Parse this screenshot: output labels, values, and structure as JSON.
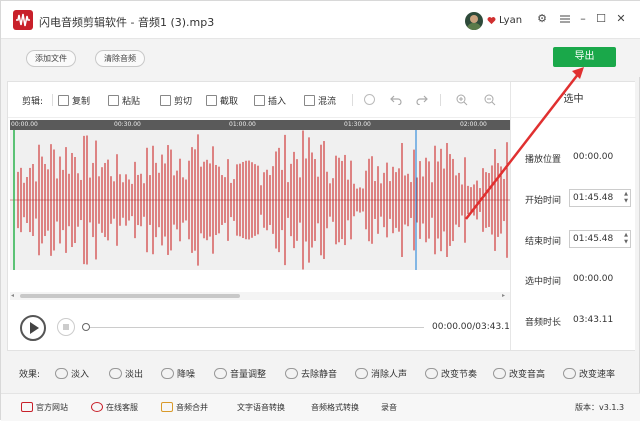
{
  "window": {
    "app_title": "闪电音频剪辑软件 - 音频1 (3).mp3",
    "user_name": "Lyan",
    "controls": {
      "settings": "⚙",
      "minimize": "–",
      "maximize": "☐",
      "close": "✕"
    }
  },
  "topbar": {
    "add_file": "添加文件",
    "clear_audio": "清除音频",
    "export": "导出"
  },
  "edit_toolbar": {
    "label": "剪辑:",
    "tools": [
      "复制",
      "粘贴",
      "剪切",
      "截取",
      "插入",
      "混流"
    ]
  },
  "ruler": {
    "ticks": [
      "00:00.00",
      "00:30.00",
      "01:00.00",
      "01:30.00",
      "02:00.00"
    ]
  },
  "player": {
    "time_display": "00:00.00/03:43.11"
  },
  "side_panel": {
    "title": "选中",
    "play_position_label": "播放位置",
    "play_position_value": "00:00.00",
    "start_time_label": "开始时间",
    "start_time_value": "01:45.48",
    "end_time_label": "结束时间",
    "end_time_value": "01:45.48",
    "selected_label": "选中时间",
    "selected_value": "00:00.00",
    "duration_label": "音频时长",
    "duration_value": "03:43.11"
  },
  "effects": {
    "label": "效果:",
    "items": [
      "淡入",
      "淡出",
      "降噪",
      "音量调整",
      "去除静音",
      "消除人声",
      "改变节奏",
      "改变音高",
      "改变速率"
    ]
  },
  "bottombar": {
    "official_site": "官方网站",
    "online_service": "在线客服",
    "audio_merge": "音频合并",
    "tts": "文字语音转换",
    "format_convert": "音频格式转换",
    "record": "录音",
    "version": "版本：v3.1.3"
  },
  "colors": {
    "accent_green": "#1aa84a",
    "brand_red": "#c8202a",
    "waveform": "#d03a3a",
    "arrow": "#e03030"
  }
}
